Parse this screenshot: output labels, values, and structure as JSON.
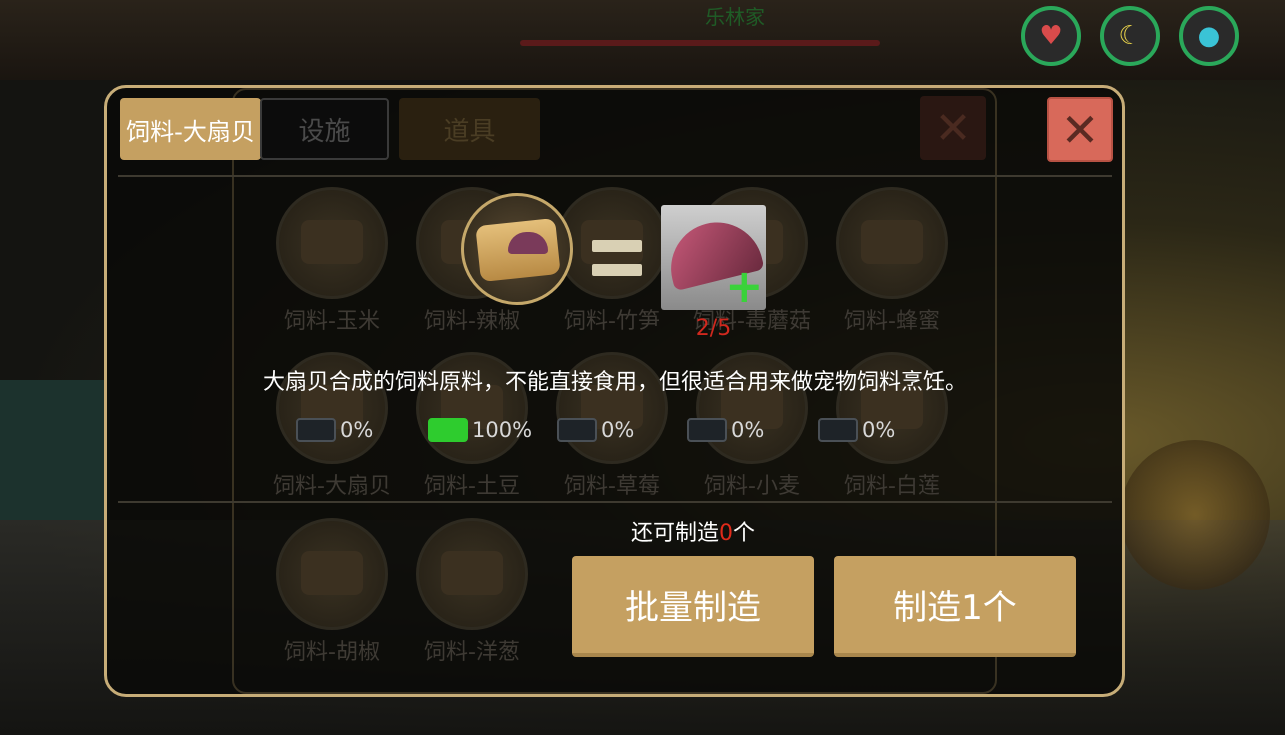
{
  "hud": {
    "banner_text": "乐林家",
    "stats": [
      {
        "name": "health",
        "icon": "heart-icon",
        "color": "#d94b4b"
      },
      {
        "name": "food",
        "icon": "banana-icon",
        "color": "#e8d24a"
      },
      {
        "name": "water",
        "icon": "water-drop-icon",
        "color": "#3ac3d6"
      }
    ]
  },
  "tabs": {
    "active": "饲料-大扇贝",
    "facility": "设施",
    "items": "道具"
  },
  "grid": [
    {
      "label": "饲料-玉米"
    },
    {
      "label": "饲料-辣椒"
    },
    {
      "label": "饲料-竹笋"
    },
    {
      "label": "饲料-毒蘑菇"
    },
    {
      "label": "饲料-蜂蜜"
    },
    {
      "label": "饲料-大扇贝"
    },
    {
      "label": "饲料-土豆"
    },
    {
      "label": "饲料-草莓"
    },
    {
      "label": "饲料-小麦"
    },
    {
      "label": "饲料-白莲"
    },
    {
      "label": "饲料-胡椒"
    },
    {
      "label": "饲料-洋葱"
    }
  ],
  "recipe": {
    "input_icon": "scallop-feed-sack-icon",
    "output_icon": "scallop-shell-icon",
    "owned_count": "2/5",
    "description": "大扇贝合成的饲料原料，不能直接食用，但很适合用来做宠物饲料烹饪。"
  },
  "progress": [
    {
      "value": "0%",
      "fraction": 0
    },
    {
      "value": "100%",
      "fraction": 1
    },
    {
      "value": "0%",
      "fraction": 0
    },
    {
      "value": "0%",
      "fraction": 0
    },
    {
      "value": "0%",
      "fraction": 0
    }
  ],
  "craft": {
    "remaining_prefix": "还可制造",
    "remaining_count": "0",
    "remaining_suffix": "个",
    "batch_label": "批量制造",
    "single_label": "制造1个"
  },
  "colors": {
    "accent_gold": "#c5a061",
    "close_red": "#d8695a",
    "progress_green": "#2ecc2e",
    "count_red": "#d0281e"
  }
}
